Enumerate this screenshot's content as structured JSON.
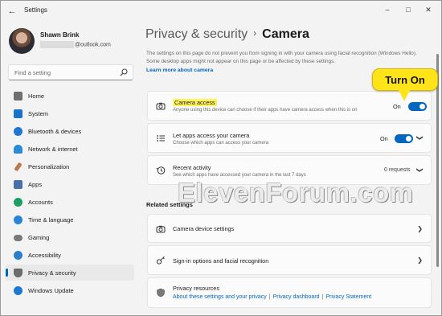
{
  "window": {
    "title": "Settings",
    "back_icon": "arrow-left-icon",
    "controls": {
      "minimize": "–",
      "maximize": "□",
      "close": "✕"
    }
  },
  "profile": {
    "name": "Shawn Brink",
    "email_suffix": "@outlook.com"
  },
  "search": {
    "placeholder": "Find a setting",
    "icon": "search-icon"
  },
  "nav": {
    "items": [
      {
        "label": "Home",
        "icon": "home-icon",
        "color": "#5a5a5a"
      },
      {
        "label": "System",
        "icon": "system-icon",
        "color": "#1a73c8"
      },
      {
        "label": "Bluetooth & devices",
        "icon": "bluetooth-icon",
        "color": "#1f77d0"
      },
      {
        "label": "Network & internet",
        "icon": "wifi-icon",
        "color": "#2b8ad8"
      },
      {
        "label": "Personalization",
        "icon": "paintbrush-icon",
        "color": "#b97b4c"
      },
      {
        "label": "Apps",
        "icon": "apps-icon",
        "color": "#4a6fa8"
      },
      {
        "label": "Accounts",
        "icon": "person-icon",
        "color": "#1e9e64"
      },
      {
        "label": "Time & language",
        "icon": "globe-clock-icon",
        "color": "#2a85d4"
      },
      {
        "label": "Gaming",
        "icon": "controller-icon",
        "color": "#7a7a7a"
      },
      {
        "label": "Accessibility",
        "icon": "accessibility-icon",
        "color": "#2a7fc9"
      },
      {
        "label": "Privacy & security",
        "icon": "shield-icon",
        "color": "#6b6b6b",
        "active": true
      },
      {
        "label": "Windows Update",
        "icon": "update-icon",
        "color": "#1f77d0"
      }
    ],
    "accent": "#0067c0"
  },
  "page": {
    "breadcrumb_parent": "Privacy & security",
    "breadcrumb_separator": "›",
    "breadcrumb_current": "Camera",
    "intro_text": "The settings on this page do not prevent you from signing in with your camera using facial recognition (Windows Hello). Some desktop apps might not appear on this page or be affected by these settings.",
    "learn_more": "Learn more about camera"
  },
  "settings": {
    "camera_access": {
      "title": "Camera access",
      "description": "Anyone using this device can choose if their apps have camera access when this is on",
      "state": "On",
      "icon": "camera-icon"
    },
    "apps_access": {
      "title": "Let apps access your camera",
      "description": "Choose which apps can access your camera",
      "state": "On",
      "icon": "list-icon"
    },
    "recent_activity": {
      "title": "Recent activity",
      "description": "See which apps have accessed your camera in the last 7 days",
      "count": "0 requests",
      "icon": "history-icon"
    }
  },
  "related": {
    "header": "Related settings",
    "camera_device": {
      "title": "Camera device settings",
      "icon": "camera-icon"
    },
    "sign_in": {
      "title": "Sign-in options and facial recognition",
      "icon": "key-icon"
    },
    "privacy_resources": {
      "title": "Privacy resources",
      "links": [
        "About these settings and your privacy",
        "Privacy dashboard",
        "Privacy Statement"
      ],
      "separator": "|",
      "icon": "shield-icon"
    }
  },
  "callout": {
    "text": "Turn On",
    "color": "#ffe41a"
  },
  "watermark": "ElevenForum.com"
}
